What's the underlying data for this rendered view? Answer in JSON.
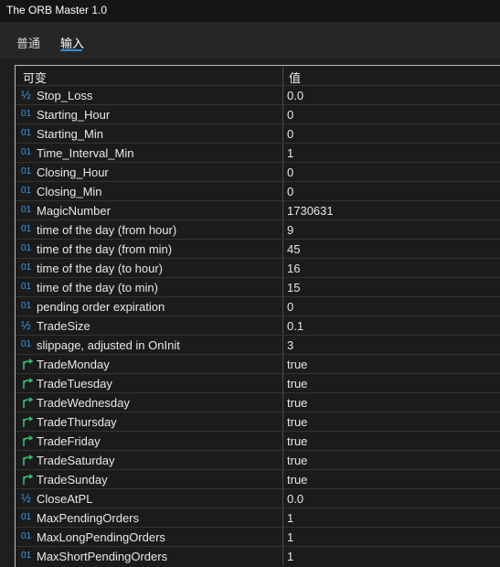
{
  "window": {
    "title": "The ORB Master 1.0"
  },
  "tabs": [
    {
      "label": "普通"
    },
    {
      "label": "输入",
      "active": true
    }
  ],
  "table": {
    "headers": {
      "variable": "可变",
      "value": "值"
    },
    "rows": [
      {
        "type": "double",
        "icon": "fraction-icon",
        "name": "Stop_Loss",
        "value": "0.0"
      },
      {
        "type": "integer",
        "icon": "integer-icon",
        "name": "Starting_Hour",
        "value": "0"
      },
      {
        "type": "integer",
        "icon": "integer-icon",
        "name": "Starting_Min",
        "value": "0"
      },
      {
        "type": "integer",
        "icon": "integer-icon",
        "name": "Time_Interval_Min",
        "value": "1"
      },
      {
        "type": "integer",
        "icon": "integer-icon",
        "name": "Closing_Hour",
        "value": "0"
      },
      {
        "type": "integer",
        "icon": "integer-icon",
        "name": "Closing_Min",
        "value": "0"
      },
      {
        "type": "integer",
        "icon": "integer-icon",
        "name": "MagicNumber",
        "value": "1730631"
      },
      {
        "type": "integer",
        "icon": "integer-icon",
        "name": "time of the day (from hour)",
        "value": "9"
      },
      {
        "type": "integer",
        "icon": "integer-icon",
        "name": "time of the day (from min)",
        "value": "45"
      },
      {
        "type": "integer",
        "icon": "integer-icon",
        "name": "time of the day (to hour)",
        "value": "16"
      },
      {
        "type": "integer",
        "icon": "integer-icon",
        "name": "time of the day (to min)",
        "value": "15"
      },
      {
        "type": "integer",
        "icon": "integer-icon",
        "name": "pending order expiration",
        "value": "0"
      },
      {
        "type": "double",
        "icon": "fraction-icon",
        "name": "TradeSize",
        "value": "0.1"
      },
      {
        "type": "integer",
        "icon": "integer-icon",
        "name": "slippage, adjusted in OnInit",
        "value": "3"
      },
      {
        "type": "bool",
        "icon": "branch-arrow-icon",
        "name": "TradeMonday",
        "value": "true"
      },
      {
        "type": "bool",
        "icon": "branch-arrow-icon",
        "name": "TradeTuesday",
        "value": "true"
      },
      {
        "type": "bool",
        "icon": "branch-arrow-icon",
        "name": "TradeWednesday",
        "value": "true"
      },
      {
        "type": "bool",
        "icon": "branch-arrow-icon",
        "name": "TradeThursday",
        "value": "true"
      },
      {
        "type": "bool",
        "icon": "branch-arrow-icon",
        "name": "TradeFriday",
        "value": "true"
      },
      {
        "type": "bool",
        "icon": "branch-arrow-icon",
        "name": "TradeSaturday",
        "value": "true"
      },
      {
        "type": "bool",
        "icon": "branch-arrow-icon",
        "name": "TradeSunday",
        "value": "true"
      },
      {
        "type": "double",
        "icon": "fraction-icon",
        "name": "CloseAtPL",
        "value": "0.0"
      },
      {
        "type": "integer",
        "icon": "integer-icon",
        "name": "MaxPendingOrders",
        "value": "1"
      },
      {
        "type": "integer",
        "icon": "integer-icon",
        "name": "MaxLongPendingOrders",
        "value": "1"
      },
      {
        "type": "integer",
        "icon": "integer-icon",
        "name": "MaxShortPendingOrders",
        "value": "1"
      }
    ]
  },
  "colors": {
    "integer_icon": "#3b9ae8",
    "bool_icon": "#2fbf71",
    "fraction_icon": "#3b9ae8",
    "tab_underline": "#2a8cde"
  },
  "icon_glyphs": {
    "integer": "01",
    "double": "½"
  }
}
